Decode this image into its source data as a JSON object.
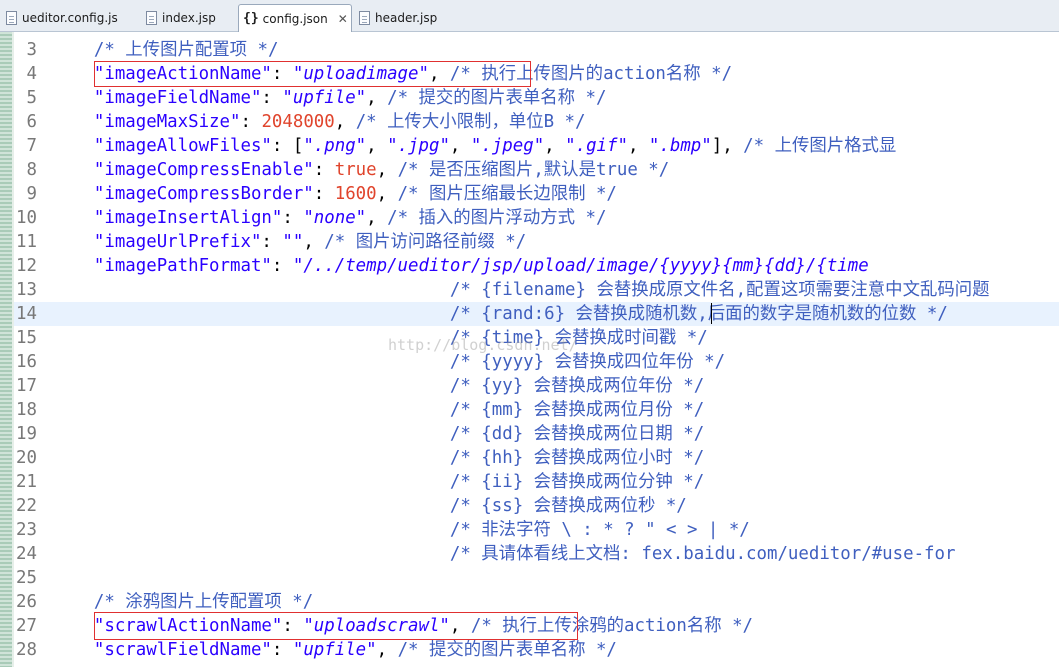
{
  "tabs": [
    {
      "label": "ueditor.config.js"
    },
    {
      "label": "index.jsp"
    },
    {
      "label": "config.json",
      "close": "✕"
    },
    {
      "label": "header.jsp"
    }
  ],
  "watermark": "http://blog.csdn.net/",
  "lines": [
    {
      "n": "3",
      "seg": [
        [
          "cm",
          "/* 上传图片配置项 */"
        ]
      ]
    },
    {
      "n": "4",
      "seg": [
        [
          "key",
          "\"imageActionName\""
        ],
        [
          "p",
          ": "
        ],
        [
          "str",
          "\"uploadimage\""
        ],
        [
          "p",
          ", "
        ],
        [
          "cm",
          "/* 执行上传图片的action名称 */"
        ]
      ]
    },
    {
      "n": "5",
      "seg": [
        [
          "key",
          "\"imageFieldName\""
        ],
        [
          "p",
          ": "
        ],
        [
          "str",
          "\"upfile\""
        ],
        [
          "p",
          ", "
        ],
        [
          "cm",
          "/* 提交的图片表单名称 */"
        ]
      ]
    },
    {
      "n": "6",
      "seg": [
        [
          "key",
          "\"imageMaxSize\""
        ],
        [
          "p",
          ": "
        ],
        [
          "num",
          "2048000"
        ],
        [
          "p",
          ", "
        ],
        [
          "cm",
          "/* 上传大小限制，单位B */"
        ]
      ]
    },
    {
      "n": "7",
      "seg": [
        [
          "key",
          "\"imageAllowFiles\""
        ],
        [
          "p",
          ": ["
        ],
        [
          "str",
          "\".png\""
        ],
        [
          "p",
          ", "
        ],
        [
          "str",
          "\".jpg\""
        ],
        [
          "p",
          ", "
        ],
        [
          "str",
          "\".jpeg\""
        ],
        [
          "p",
          ", "
        ],
        [
          "str",
          "\".gif\""
        ],
        [
          "p",
          ", "
        ],
        [
          "str",
          "\".bmp\""
        ],
        [
          "p",
          "], "
        ],
        [
          "cm",
          "/* 上传图片格式显"
        ]
      ]
    },
    {
      "n": "8",
      "seg": [
        [
          "key",
          "\"imageCompressEnable\""
        ],
        [
          "p",
          ": "
        ],
        [
          "kw",
          "true"
        ],
        [
          "p",
          ", "
        ],
        [
          "cm",
          "/* 是否压缩图片,默认是true */"
        ]
      ]
    },
    {
      "n": "9",
      "seg": [
        [
          "key",
          "\"imageCompressBorder\""
        ],
        [
          "p",
          ": "
        ],
        [
          "num",
          "1600"
        ],
        [
          "p",
          ", "
        ],
        [
          "cm",
          "/* 图片压缩最长边限制 */"
        ]
      ]
    },
    {
      "n": "10",
      "seg": [
        [
          "key",
          "\"imageInsertAlign\""
        ],
        [
          "p",
          ": "
        ],
        [
          "str",
          "\"none\""
        ],
        [
          "p",
          ", "
        ],
        [
          "cm",
          "/* 插入的图片浮动方式 */"
        ]
      ]
    },
    {
      "n": "11",
      "seg": [
        [
          "key",
          "\"imageUrlPrefix\""
        ],
        [
          "p",
          ": "
        ],
        [
          "str",
          "\"\""
        ],
        [
          "p",
          ", "
        ],
        [
          "cm",
          "/* 图片访问路径前缀 */"
        ]
      ]
    },
    {
      "n": "12",
      "seg": [
        [
          "key",
          "\"imagePathFormat\""
        ],
        [
          "p",
          ": "
        ],
        [
          "str",
          "\"/../temp/ueditor/jsp/upload/image/{yyyy}{mm}{dd}/{time"
        ]
      ]
    },
    {
      "n": "13",
      "seg": [
        [
          "cm",
          "                                  /* {filename} 会替换成原文件名,配置这项需要注意中文乱码问题"
        ]
      ]
    },
    {
      "n": "14",
      "current": true,
      "seg": [
        [
          "cm",
          "                                  /* {rand:6} 会替换成随机数,后面的数字是随机数的位数 */"
        ]
      ]
    },
    {
      "n": "15",
      "seg": [
        [
          "cm",
          "                                  /* {time} 会替换成时间戳 */"
        ]
      ]
    },
    {
      "n": "16",
      "seg": [
        [
          "cm",
          "                                  /* {yyyy} 会替换成四位年份 */"
        ]
      ]
    },
    {
      "n": "17",
      "seg": [
        [
          "cm",
          "                                  /* {yy} 会替换成两位年份 */"
        ]
      ]
    },
    {
      "n": "18",
      "seg": [
        [
          "cm",
          "                                  /* {mm} 会替换成两位月份 */"
        ]
      ]
    },
    {
      "n": "19",
      "seg": [
        [
          "cm",
          "                                  /* {dd} 会替换成两位日期 */"
        ]
      ]
    },
    {
      "n": "20",
      "seg": [
        [
          "cm",
          "                                  /* {hh} 会替换成两位小时 */"
        ]
      ]
    },
    {
      "n": "21",
      "seg": [
        [
          "cm",
          "                                  /* {ii} 会替换成两位分钟 */"
        ]
      ]
    },
    {
      "n": "22",
      "seg": [
        [
          "cm",
          "                                  /* {ss} 会替换成两位秒 */"
        ]
      ]
    },
    {
      "n": "23",
      "seg": [
        [
          "cm",
          "                                  /* 非法字符 \\ : * ? \" < > | */"
        ]
      ]
    },
    {
      "n": "24",
      "seg": [
        [
          "cm",
          "                                  /* 具请体看线上文档: fex.baidu.com/ueditor/#use-for"
        ]
      ]
    },
    {
      "n": "25",
      "seg": []
    },
    {
      "n": "26",
      "seg": [
        [
          "cm",
          "/* 涂鸦图片上传配置项 */"
        ]
      ]
    },
    {
      "n": "27",
      "seg": [
        [
          "key",
          "\"scrawlActionName\""
        ],
        [
          "p",
          ": "
        ],
        [
          "str",
          "\"uploadscrawl\""
        ],
        [
          "p",
          ", "
        ],
        [
          "cm",
          "/* 执行上传涂鸦的action名称 */"
        ]
      ]
    },
    {
      "n": "28",
      "seg": [
        [
          "key",
          "\"scrawlFieldName\""
        ],
        [
          "p",
          ": "
        ],
        [
          "str",
          "\"upfile\""
        ],
        [
          "p",
          ", "
        ],
        [
          "cm",
          "/* 提交的图片表单名称 */"
        ]
      ]
    }
  ]
}
